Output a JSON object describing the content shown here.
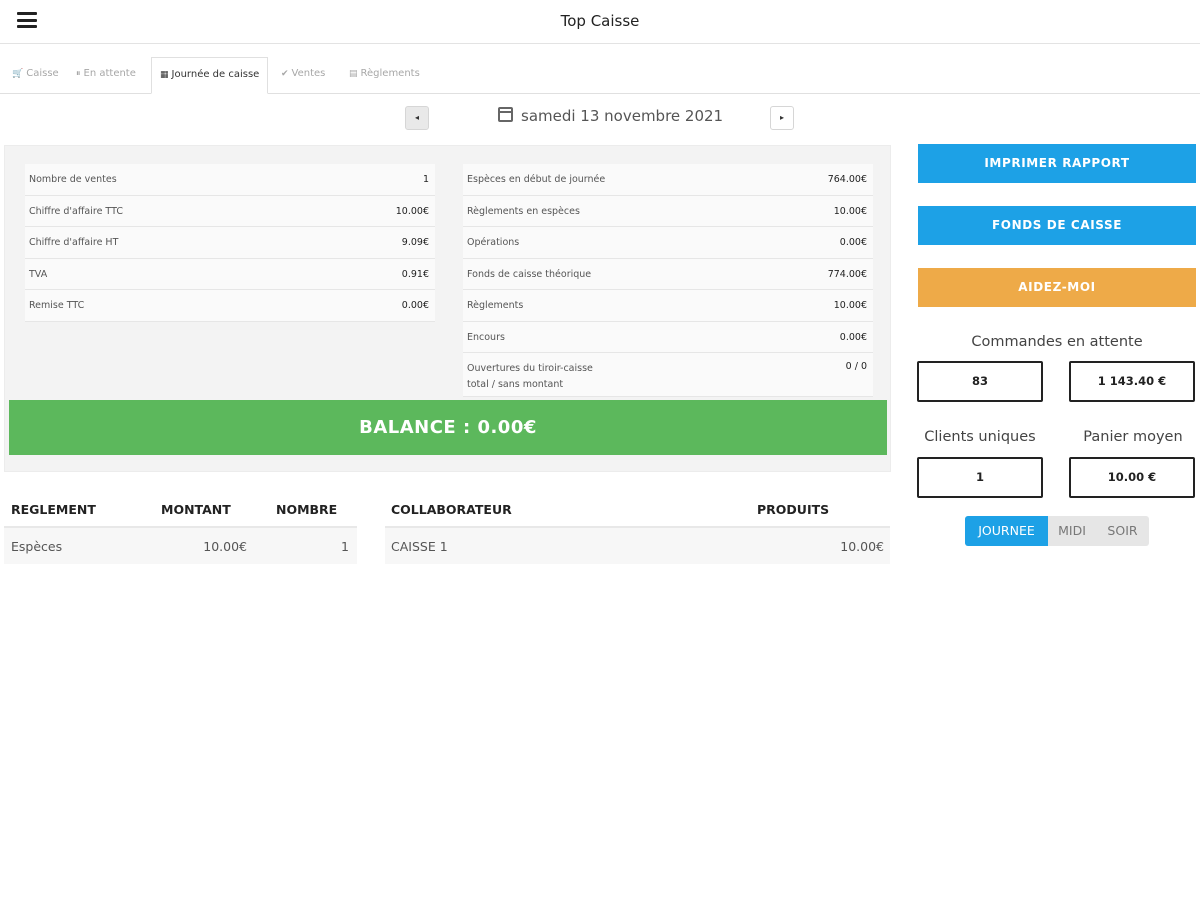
{
  "app": {
    "title": "Top Caisse"
  },
  "icons": {
    "menu": "hamburger-icon",
    "cart": "cart-icon",
    "pause": "pause-icon",
    "calendar": "calendar-icon",
    "check": "check-icon",
    "payments": "payments-icon",
    "prev": "caret-left-icon",
    "next": "caret-right-icon"
  },
  "tabs": [
    {
      "icon": "🛒",
      "label": "Caisse"
    },
    {
      "icon": "⏸",
      "label": "En attente"
    },
    {
      "icon": "▦",
      "label": "Journée de caisse"
    },
    {
      "icon": "✔",
      "label": "Ventes"
    },
    {
      "icon": "▤",
      "label": "Règlements"
    }
  ],
  "date_nav": {
    "prev": "◂",
    "next": "▸",
    "date": "samedi 13 novembre 2021"
  },
  "summary_left": [
    {
      "label": "Nombre de ventes",
      "value": "1"
    },
    {
      "label": "Chiffre d'affaire TTC",
      "value": "10.00€"
    },
    {
      "label": "Chiffre d'affaire HT",
      "value": "9.09€"
    },
    {
      "label": "TVA",
      "value": "0.91€"
    },
    {
      "label": "Remise TTC",
      "value": "0.00€"
    }
  ],
  "summary_right": [
    {
      "label": "Espèces en début de journée",
      "value": "764.00€"
    },
    {
      "label": "Règlements en espèces",
      "value": "10.00€"
    },
    {
      "label": "Opérations",
      "value": "0.00€"
    },
    {
      "label": "Fonds de caisse théorique",
      "value": "774.00€"
    },
    {
      "label": "Règlements",
      "value": "10.00€"
    },
    {
      "label": "Encours",
      "value": "0.00€"
    },
    {
      "label": "Ouvertures du tiroir-caisse",
      "label2": "total / sans montant",
      "value": "0 / 0"
    }
  ],
  "balance": "BALANCE : 0.00€",
  "payments_table": {
    "headers": [
      "REGLEMENT",
      "MONTANT",
      "NOMBRE"
    ],
    "rows": [
      [
        "Espèces",
        "10.00€",
        "1"
      ]
    ]
  },
  "staff_table": {
    "headers": [
      "COLLABORATEUR",
      "PRODUITS"
    ],
    "rows": [
      [
        "CAISSE 1",
        "10.00€"
      ]
    ]
  },
  "actions": {
    "print": "IMPRIMER RAPPORT",
    "float": "FONDS DE CAISSE",
    "help": "AIDEZ-MOI"
  },
  "pending": {
    "label": "Commandes en attente",
    "count": "83",
    "amount": "1 143.40 €"
  },
  "unique_clients": {
    "label": "Clients uniques",
    "value": "1"
  },
  "avg_basket": {
    "label": "Panier moyen",
    "value": "10.00 €"
  },
  "period": {
    "options": [
      "JOURNEE",
      "MIDI",
      "SOIR"
    ],
    "selected": "JOURNEE"
  },
  "colors": {
    "accent": "#1da1e6",
    "success": "#5cb85c",
    "warning": "#eeaa48"
  }
}
